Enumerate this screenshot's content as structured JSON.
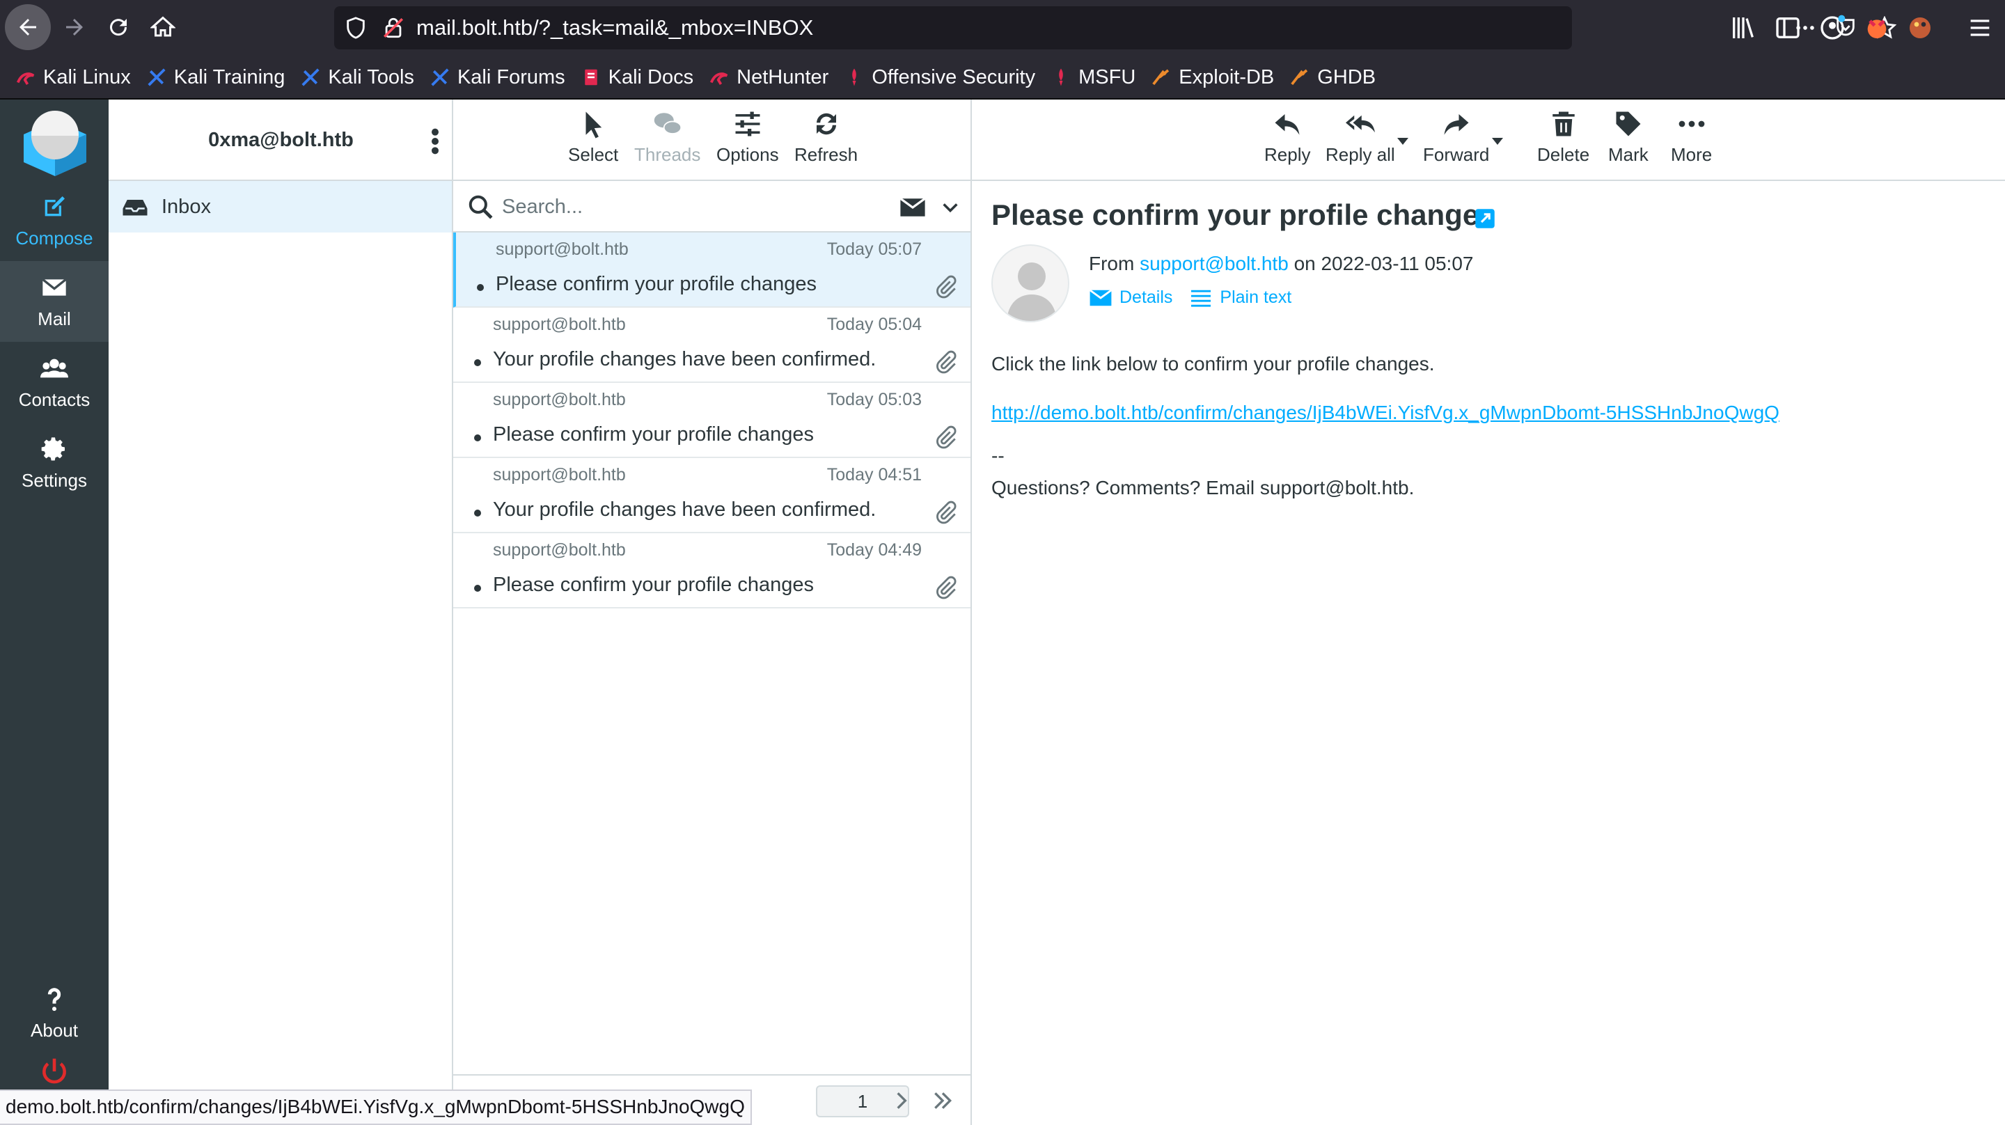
{
  "browser": {
    "url": "mail.bolt.htb/?_task=mail&_mbox=INBOX",
    "bookmarks": [
      {
        "label": "Kali Linux",
        "icon": "kali-dragon-icon"
      },
      {
        "label": "Kali Training",
        "icon": "kali-tools-icon"
      },
      {
        "label": "Kali Tools",
        "icon": "kali-tools-icon"
      },
      {
        "label": "Kali Forums",
        "icon": "kali-tools-icon"
      },
      {
        "label": "Kali Docs",
        "icon": "kali-docs-icon"
      },
      {
        "label": "NetHunter",
        "icon": "kali-dragon-icon"
      },
      {
        "label": "Offensive Security",
        "icon": "offsec-icon"
      },
      {
        "label": "MSFU",
        "icon": "offsec-icon"
      },
      {
        "label": "Exploit-DB",
        "icon": "exploitdb-icon"
      },
      {
        "label": "GHDB",
        "icon": "exploitdb-icon"
      }
    ],
    "status_link": "demo.bolt.htb/confirm/changes/IjB4bWEi.YisfVg.x_gMwpnDbomt-5HSSHnbJnoQwgQ"
  },
  "nav": {
    "compose": "Compose",
    "mail": "Mail",
    "contacts": "Contacts",
    "settings": "Settings",
    "about": "About"
  },
  "folders": {
    "account": "0xma@bolt.htb",
    "inbox": "Inbox"
  },
  "list_toolbar": {
    "select": "Select",
    "threads": "Threads",
    "options": "Options",
    "refresh": "Refresh"
  },
  "search": {
    "placeholder": "Search..."
  },
  "messages": [
    {
      "from": "support@bolt.htb",
      "date": "Today 05:07",
      "subject": "Please confirm your profile changes"
    },
    {
      "from": "support@bolt.htb",
      "date": "Today 05:04",
      "subject": "Your profile changes have been confirmed."
    },
    {
      "from": "support@bolt.htb",
      "date": "Today 05:03",
      "subject": "Please confirm your profile changes"
    },
    {
      "from": "support@bolt.htb",
      "date": "Today 04:51",
      "subject": "Your profile changes have been confirmed."
    },
    {
      "from": "support@bolt.htb",
      "date": "Today 04:49",
      "subject": "Please confirm your profile changes"
    }
  ],
  "pagination": {
    "page": "1"
  },
  "reader_toolbar": {
    "reply": "Reply",
    "reply_all": "Reply all",
    "forward": "Forward",
    "delete": "Delete",
    "mark": "Mark",
    "more": "More"
  },
  "mail": {
    "subject": "Please confirm your profile changes",
    "from_prefix": "From",
    "from_address": "support@bolt.htb",
    "date_text": "on 2022-03-11 05:07",
    "details": "Details",
    "plain_text": "Plain text",
    "body": "Click the link below to confirm your profile changes.",
    "link": "http://demo.bolt.htb/confirm/changes/IjB4bWEi.YisfVg.x_gMwpnDbomt-5HSSHnbJnoQwgQ",
    "sig_separator": "--",
    "signature": "Questions? Comments? Email support@bolt.htb."
  },
  "colors": {
    "accent": "#37beff",
    "link": "#00acff",
    "sidebar": "#2f3a3f",
    "browser_chrome": "#2b2a33"
  }
}
